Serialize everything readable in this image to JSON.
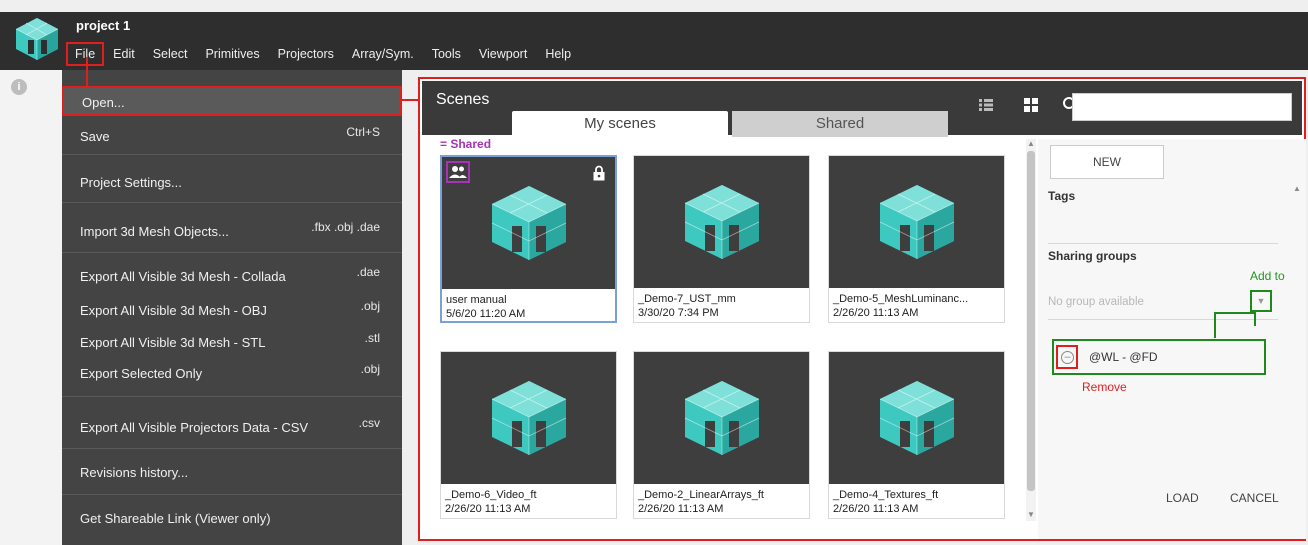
{
  "app": {
    "project_title": "project 1",
    "menu": [
      "File",
      "Edit",
      "Select",
      "Primitives",
      "Projectors",
      "Array/Sym.",
      "Tools",
      "Viewport",
      "Help"
    ]
  },
  "file_menu": {
    "items": [
      {
        "label": "Open...",
        "shortcut": ""
      },
      {
        "label": "Save",
        "shortcut": "Ctrl+S"
      },
      {
        "label": "Project Settings...",
        "shortcut": ""
      },
      {
        "label": "Import 3d Mesh Objects...",
        "shortcut": ".fbx .obj .dae"
      },
      {
        "label": "Export All Visible 3d Mesh - Collada",
        "shortcut": ".dae"
      },
      {
        "label": "Export All Visible 3d Mesh - OBJ",
        "shortcut": ".obj"
      },
      {
        "label": "Export All Visible 3d Mesh - STL",
        "shortcut": ".stl"
      },
      {
        "label": "Export Selected Only",
        "shortcut": ".obj"
      },
      {
        "label": "Export All Visible Projectors Data - CSV",
        "shortcut": ".csv"
      },
      {
        "label": "Revisions history...",
        "shortcut": ""
      },
      {
        "label": "Get Shareable Link (Viewer only)",
        "shortcut": ""
      }
    ]
  },
  "dialog": {
    "title": "Scenes",
    "tabs": [
      "My scenes",
      "Shared"
    ],
    "search_placeholder": "",
    "shared_legend": "= Shared",
    "scenes": [
      {
        "name": "user manual",
        "date": "5/6/20 11:20 AM",
        "shared": true,
        "locked": true,
        "selected": true
      },
      {
        "name": "_Demo-7_UST_mm",
        "date": "3/30/20 7:34 PM",
        "shared": false,
        "locked": false,
        "selected": false
      },
      {
        "name": "_Demo-5_MeshLuminanc...",
        "date": "2/26/20 11:13 AM",
        "shared": false,
        "locked": false,
        "selected": false
      },
      {
        "name": "_Demo-6_Video_ft",
        "date": "2/26/20 11:13 AM",
        "shared": false,
        "locked": false,
        "selected": false
      },
      {
        "name": "_Demo-2_LinearArrays_ft",
        "date": "2/26/20 11:13 AM",
        "shared": false,
        "locked": false,
        "selected": false
      },
      {
        "name": "_Demo-4_Textures_ft",
        "date": "2/26/20 11:13 AM",
        "shared": false,
        "locked": false,
        "selected": false
      }
    ],
    "right_panel": {
      "new_label": "NEW",
      "tags_label": "Tags",
      "sharing_groups_label": "Sharing groups",
      "add_to_label": "Add to",
      "no_group_text": "No group available",
      "groups": [
        "@WL - @FD"
      ],
      "remove_label": "Remove",
      "load_label": "LOAD",
      "cancel_label": "CANCEL"
    }
  },
  "colors": {
    "highlight_red": "#e01e1e",
    "highlight_green": "#1e8a1e",
    "shared_purple": "#a833b8",
    "logo_teal": "#3ec9c0"
  }
}
